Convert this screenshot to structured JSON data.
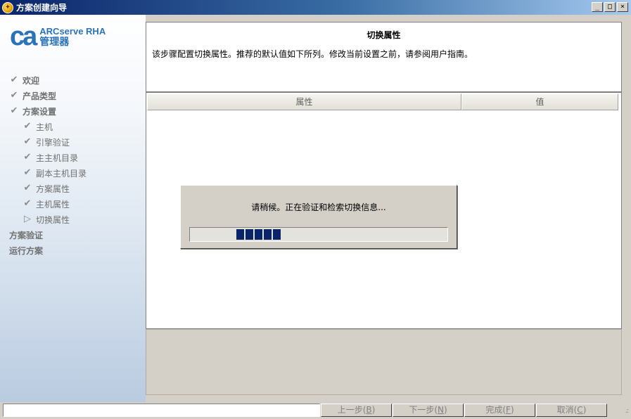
{
  "window": {
    "title": "方案创建向导"
  },
  "logo": {
    "brand": "ca",
    "product": "ARCserve RHA",
    "subtitle": "管理器"
  },
  "nav": {
    "items": [
      {
        "label": "欢迎",
        "level": "main",
        "icon": "check-icon"
      },
      {
        "label": "产品类型",
        "level": "main",
        "icon": "check-icon"
      },
      {
        "label": "方案设置",
        "level": "main",
        "icon": "check-icon"
      },
      {
        "label": "主机",
        "level": "sub",
        "icon": "check-icon"
      },
      {
        "label": "引擎验证",
        "level": "sub",
        "icon": "check-icon"
      },
      {
        "label": "主主机目录",
        "level": "sub",
        "icon": "check-icon"
      },
      {
        "label": "副本主机目录",
        "level": "sub",
        "icon": "check-icon"
      },
      {
        "label": "方案属性",
        "level": "sub",
        "icon": "check-icon"
      },
      {
        "label": "主机属性",
        "level": "sub",
        "icon": "check-icon"
      },
      {
        "label": "切换属性",
        "level": "sub",
        "icon": "arrow-right-icon"
      },
      {
        "label": "方案验证",
        "level": "main",
        "icon": ""
      },
      {
        "label": "运行方案",
        "level": "main",
        "icon": ""
      }
    ]
  },
  "content": {
    "heading": "切换属性",
    "description": "该步骤配置切换属性。推荐的默认值如下所列。修改当前设置之前，请参阅用户指南。"
  },
  "table": {
    "columns": [
      "属性",
      "值"
    ]
  },
  "dialog": {
    "message": "请稍候。正在验证和检索切换信息...",
    "progress_blocks": 5
  },
  "buttons": {
    "prev": {
      "label": "上一步(",
      "key": "B",
      "end": ")"
    },
    "next": {
      "label": "下一步(",
      "key": "N",
      "end": ")"
    },
    "finish": {
      "label": "完成(",
      "key": "F",
      "end": ")"
    },
    "cancel": {
      "label": "取消(",
      "key": "C",
      "end": ")"
    }
  },
  "colors": {
    "accent": "#2a73b8",
    "titlebar": "#0a246a",
    "progress": "#0a246a"
  }
}
